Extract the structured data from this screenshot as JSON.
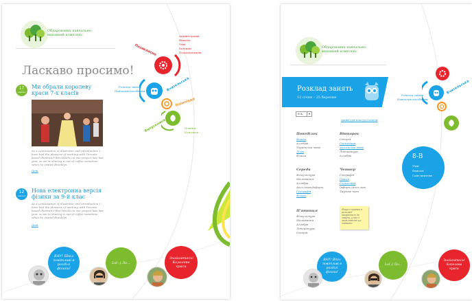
{
  "left": {
    "logo_text": "Обдарованих навчально-виховний комплекс",
    "title": "Ласкаво просимо!",
    "news": [
      {
        "day": "17",
        "month": "серпня",
        "title": "Ми обрали королеву краси 7-х класів",
        "text": "As a continuation of illustrator and introduction I have had the pleasure of working with Toronto-based illustrator Ben Weeks on one project late last year, so we're sharing a cup of coffee sometime when he visited Brooklyn.",
        "more": "Далі"
      },
      {
        "day": "12",
        "month": "серпня",
        "title": "Нова електронна версія фізики за 9-й клас",
        "text": "As a continuation of illustrator and introduction I have had the pleasure of working with Toronto-based illustrator Ben Weeks on one project late last year, so we're sharing a cup of coffee sometime when he visited Brooklyn.",
        "more": "Далі"
      }
    ],
    "menu": {
      "red_label": "Позакласне",
      "red_items": [
        "Адміністрація",
        "Вчителі",
        "Учні",
        "Батькам",
        "Педагоги-вчені"
      ],
      "blue_label": "Вчительська",
      "blue_items": [
        "Розклад занять",
        "Навчальні посібники"
      ],
      "orange_label": "Олімпіади",
      "green_label": "Випускники",
      "green_items": [
        "Новини",
        "Контакти"
      ]
    },
    "bubbles": [
      "ВАУ! Шкіл повітливі в розділі фізики!",
      "Lol :) Ло...",
      "Знайомтесь! Королева краси"
    ]
  },
  "right": {
    "logo_text": "Обдарованих навчально-виховний комплекс",
    "schedule_title": "Розклад занять",
    "schedule_dates": "12 січня – 25 березня",
    "class_select": "8-А",
    "top_links": [
      "зміни для класу",
      "усі класи"
    ],
    "days": [
      {
        "name": "Понеділок",
        "items": [
          "Фізика",
          "Алгебра",
          "Українська мова",
          "Лі-ра",
          "Фізика"
        ]
      },
      {
        "name": "Вівторок",
        "items": [
          "Історія",
          "Геометрія",
          "Англійська мова",
          "Література",
          "Алгебра"
        ]
      },
      {
        "name": "Середа",
        "items": [
          "Фізкультура",
          "Малювання",
          "Алгебра",
          "Англ.мова/Інформ.",
          "Географія",
          "Фізика"
        ]
      },
      {
        "name": "Четвер",
        "items": [
          "Географія",
          "Праця",
          "Геометрія",
          "Інформ./Англ.мов.",
          "Трудове навч."
        ]
      },
      {
        "name": "П'ятниця",
        "items": [
          "Фізкультура",
          "Малювання",
          "Алгебра",
          "Література",
          "Історія"
        ]
      }
    ],
    "sticky_note": "Якщо є правки в розкладі зверніться до завуча, у нас є можливість це змінити",
    "menu": {
      "blue_items": [
        "Розклад занять",
        "Навчальні посібники"
      ],
      "blue_label": "Вчительська"
    },
    "class_circle": {
      "title": "8-В",
      "items": [
        "Учні",
        "Вчителі",
        "Сайт вчителя"
      ]
    },
    "bubbles": [
      "ВАУ! Шкіл повітливі в розділі фізики!",
      "Lol :) Ло...",
      "Знайомтесь! Королева краси"
    ]
  },
  "colors": {
    "green": "#7cbc2e",
    "blue": "#1aa3e6",
    "red": "#e8242c",
    "orange": "#f7941d"
  }
}
